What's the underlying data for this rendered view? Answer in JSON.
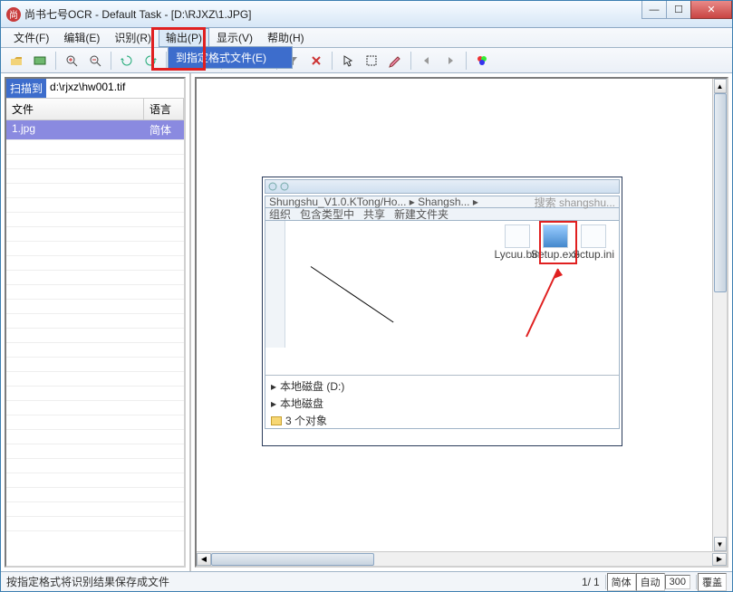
{
  "title": "尚书七号OCR - Default Task - [D:\\RJXZ\\1.JPG]",
  "menu": {
    "file": "文件(F)",
    "edit": "编辑(E)",
    "recognize": "识别(R)",
    "output": "输出(P)",
    "view": "显示(V)",
    "help": "帮助(H)"
  },
  "dropdown": {
    "to_format_file": "到指定格式文件(E)"
  },
  "left_panel": {
    "scan_label": "扫描到",
    "scan_path": "d:\\rjxz\\hw001.tif",
    "header_file": "文件",
    "header_lang": "语言",
    "rows": [
      {
        "file": "1.jpg",
        "lang": "简体"
      }
    ]
  },
  "mock": {
    "nav_path": "Shungshu_V1.0.KTong/Ho... ▸ Shangsh... ▸",
    "search_hint": "搜索 shangshu...",
    "tool1": "组织",
    "tool2": "包含类型中",
    "tool3": "共享",
    "tool4": "新建文件夹",
    "file1": "Lycuu.bin",
    "file2": "Setup.exe",
    "file3": "Sctup.ini",
    "bottom1": "本地磁盘 (D:)",
    "bottom2": "本地磁盘",
    "bottom3": "3 个对象"
  },
  "status": {
    "message": "按指定格式将识别结果保存成文件",
    "page_cur": "1/",
    "page_total": "1",
    "lang": "简体",
    "auto": "自动",
    "dpi": "300",
    "overwrite": "覆盖"
  }
}
